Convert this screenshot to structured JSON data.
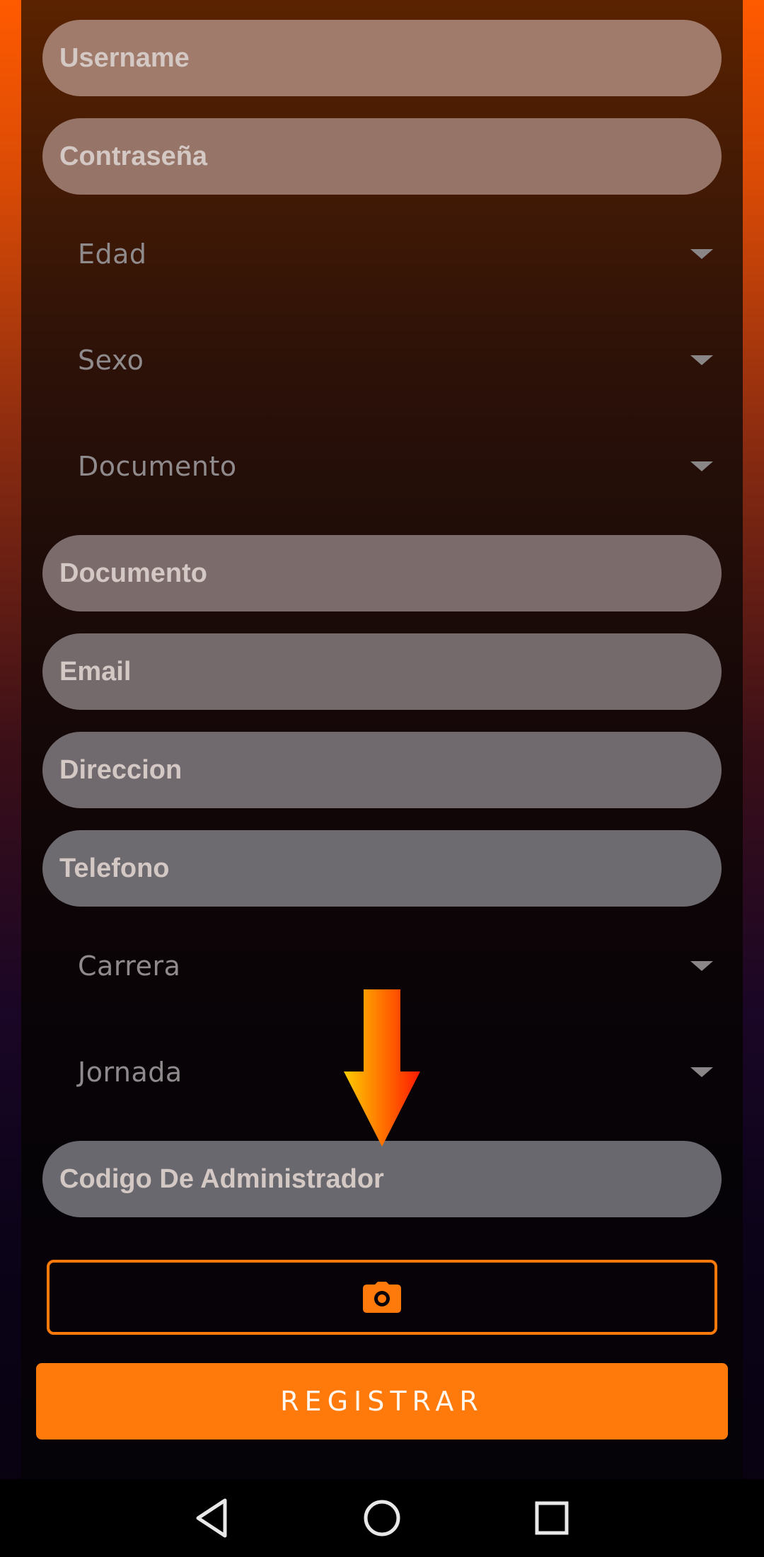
{
  "form": {
    "username_placeholder": "Username",
    "password_placeholder": "Contraseña",
    "age_dropdown": "Edad",
    "sex_dropdown": "Sexo",
    "document_type_dropdown": "Documento",
    "document_placeholder": "Documento",
    "email_placeholder": "Email",
    "address_placeholder": "Direccion",
    "phone_placeholder": "Telefono",
    "career_dropdown": "Carrera",
    "schedule_dropdown": "Jornada",
    "admin_code_placeholder": "Codigo De Administrador",
    "photo_button_icon": "camera-icon",
    "register_label": "REGISTRAR"
  },
  "navbar": {
    "back_icon": "back-triangle-icon",
    "home_icon": "home-circle-icon",
    "recents_icon": "recents-square-icon"
  },
  "colors": {
    "accent": "#ff7a0a",
    "arrow_gradient_start": "#ffcc00",
    "arrow_gradient_end": "#ff1a00"
  }
}
